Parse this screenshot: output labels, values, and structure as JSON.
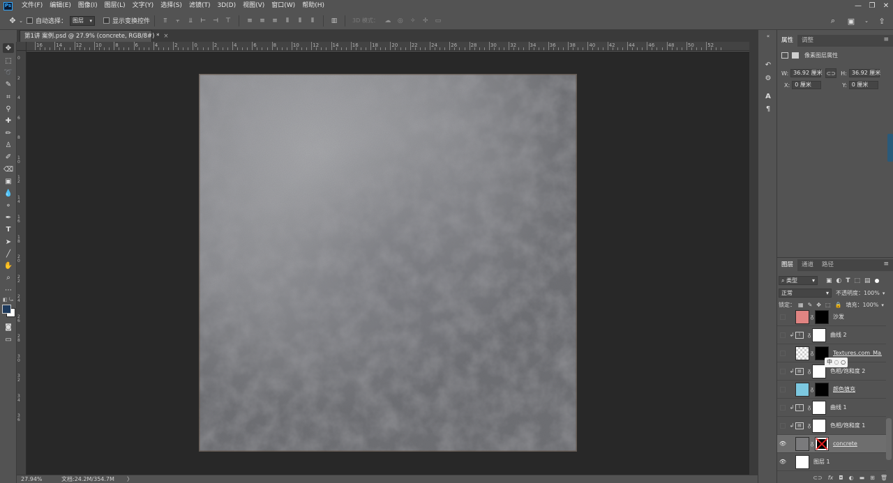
{
  "app": {
    "logo": "Ps"
  },
  "menu": [
    "文件(F)",
    "编辑(E)",
    "图像(I)",
    "图层(L)",
    "文字(Y)",
    "选择(S)",
    "滤镜(T)",
    "3D(D)",
    "视图(V)",
    "窗口(W)",
    "帮助(H)"
  ],
  "window_controls": [
    "—",
    "❐",
    "✕"
  ],
  "options": {
    "auto_select_label": "自动选择：",
    "auto_select_value": "图层",
    "show_transform_label": "显示变换控件",
    "mode_3d_label": "3D 模式："
  },
  "document": {
    "tab_title": "第1讲 案例.psd @ 27.9% (concrete, RGB/8#) *",
    "tab_close": "×"
  },
  "ruler": {
    "top_labels": [
      "16",
      "14",
      "12",
      "10",
      "8",
      "6",
      "4",
      "2",
      "0",
      "2",
      "4",
      "6",
      "8",
      "10",
      "12",
      "14",
      "16",
      "18",
      "20",
      "22",
      "24",
      "26",
      "28",
      "30",
      "32",
      "34",
      "36",
      "38",
      "40",
      "42",
      "44",
      "46",
      "48",
      "50",
      "52"
    ],
    "left_labels": [
      "0",
      "2",
      "4",
      "6",
      "8",
      "10",
      "12",
      "14",
      "16",
      "18",
      "20",
      "22",
      "24",
      "26",
      "28",
      "30",
      "32",
      "34",
      "36"
    ]
  },
  "status": {
    "zoom": "27.94%",
    "doc_info": "文档:24.2M/354.7M",
    "arrow": "〉"
  },
  "properties": {
    "tabs": [
      "属性",
      "调整"
    ],
    "title": "像素图层属性",
    "w_label": "W:",
    "w_value": "36.92 厘米",
    "h_label": "H:",
    "h_value": "36.92 厘米",
    "x_label": "X:",
    "x_value": "0 厘米",
    "y_label": "Y:",
    "y_value": "0 厘米"
  },
  "layers_panel": {
    "tabs": [
      "图层",
      "通道",
      "路径"
    ],
    "filter_value": "类型",
    "blend_mode": "正常",
    "opacity_label": "不透明度：",
    "opacity_value": "100%",
    "lock_label": "锁定：",
    "fill_label": "填充：",
    "fill_value": "100%",
    "float_hint": "中 ◌ ○",
    "layers": [
      {
        "name": "沙发",
        "visible": false,
        "clipped": false,
        "adjust": false,
        "thumb": "#e08482",
        "mask": "#000000",
        "selected": false,
        "underline": false
      },
      {
        "name": "曲线 2",
        "visible": false,
        "clipped": true,
        "adjust": true,
        "thumb": "",
        "mask": "#ffffff",
        "selected": false,
        "underline": false
      },
      {
        "name": "Textures.com_Ma...",
        "visible": false,
        "clipped": false,
        "adjust": false,
        "thumb": "checker",
        "mask": "#000000",
        "selected": false,
        "underline": true
      },
      {
        "name": "色相/饱和度 2",
        "visible": false,
        "clipped": true,
        "adjust": true,
        "thumb": "",
        "mask": "#ffffff",
        "selected": false,
        "underline": false
      },
      {
        "name": "颜色填充",
        "visible": false,
        "clipped": false,
        "adjust": false,
        "thumb": "#7cc8e0",
        "mask": "#000000",
        "selected": false,
        "underline": true
      },
      {
        "name": "曲线 1",
        "visible": false,
        "clipped": true,
        "adjust": true,
        "thumb": "",
        "mask": "#ffffff",
        "selected": false,
        "underline": false
      },
      {
        "name": "色相/饱和度 1",
        "visible": false,
        "clipped": true,
        "adjust": true,
        "thumb": "",
        "mask": "#ffffff",
        "selected": false,
        "underline": false
      },
      {
        "name": "concrete",
        "visible": true,
        "clipped": false,
        "adjust": false,
        "thumb": "#7a7a7c",
        "mask": "redx",
        "selected": true,
        "underline": true
      },
      {
        "name": "图层 1",
        "visible": true,
        "clipped": false,
        "adjust": false,
        "thumb": "#ffffff",
        "mask": "",
        "selected": false,
        "underline": false
      }
    ],
    "footer_icons": [
      "link-icon",
      "fx-icon",
      "mask-icon",
      "adjustment-icon",
      "folder-icon",
      "new-layer-icon",
      "trash-icon"
    ]
  },
  "colors": {
    "ui_bg": "#535353",
    "canvas_bg": "#282828",
    "concrete_base": "#8c8d90",
    "foreground": "#1e3a5c",
    "background": "#ffffff"
  },
  "tools": [
    "move-tool-icon",
    "marquee-tool-icon",
    "lasso-tool-icon",
    "quick-select-tool-icon",
    "crop-tool-icon",
    "eyedropper-tool-icon",
    "healing-tool-icon",
    "brush-tool-icon",
    "stamp-tool-icon",
    "history-brush-tool-icon",
    "eraser-tool-icon",
    "gradient-tool-icon",
    "blur-tool-icon",
    "dodge-tool-icon",
    "pen-tool-icon",
    "type-tool-icon",
    "path-select-tool-icon",
    "line-tool-icon",
    "hand-tool-icon",
    "zoom-tool-icon",
    "more-tools-icon"
  ]
}
